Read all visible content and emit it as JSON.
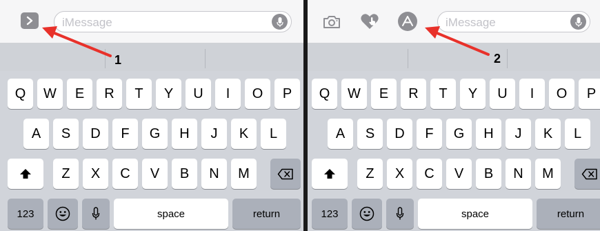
{
  "left": {
    "input_placeholder": "iMessage",
    "annotation": "1",
    "tool_icons": [
      "chevron-right-icon"
    ]
  },
  "right": {
    "input_placeholder": "iMessage",
    "annotation": "2",
    "tool_icons": [
      "camera-icon",
      "digital-touch-icon",
      "app-store-icon"
    ]
  },
  "keyboard": {
    "row1": [
      "Q",
      "W",
      "E",
      "R",
      "T",
      "Y",
      "U",
      "I",
      "O",
      "P"
    ],
    "row2": [
      "A",
      "S",
      "D",
      "F",
      "G",
      "H",
      "J",
      "K",
      "L"
    ],
    "row3": [
      "Z",
      "X",
      "C",
      "V",
      "B",
      "N",
      "M"
    ],
    "numbers_label": "123",
    "space_label": "space",
    "return_label": "return"
  },
  "colors": {
    "arrow": "#e8312a",
    "keyboard_bg": "#d1d4da",
    "key_bg": "#ffffff",
    "function_key_bg": "#abb0ba",
    "icon_gray": "#8e8e93"
  }
}
